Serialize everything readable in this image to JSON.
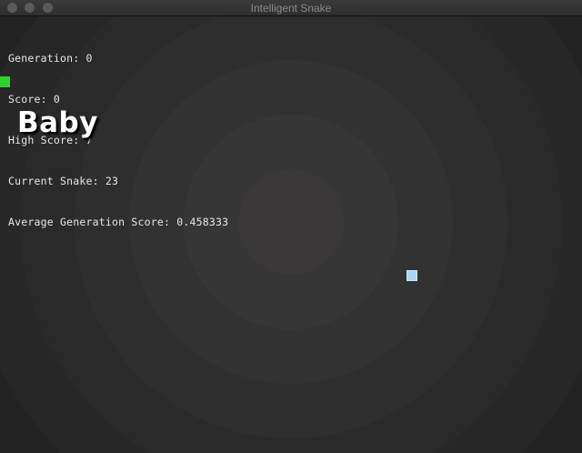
{
  "window": {
    "title": "Intelligent Snake"
  },
  "stats": {
    "generation": "Generation: 0",
    "score": "Score: 0",
    "high_score": "High Score: 7",
    "current_snake": "Current Snake: 23",
    "average_generation_score": "Average Generation Score: 0.458333"
  },
  "caption": "Baby",
  "colors": {
    "snake": "#2fd12f",
    "food": "#a9d8f5",
    "stat_text": "#e8e8e8",
    "caption_text": "#ffffff"
  }
}
